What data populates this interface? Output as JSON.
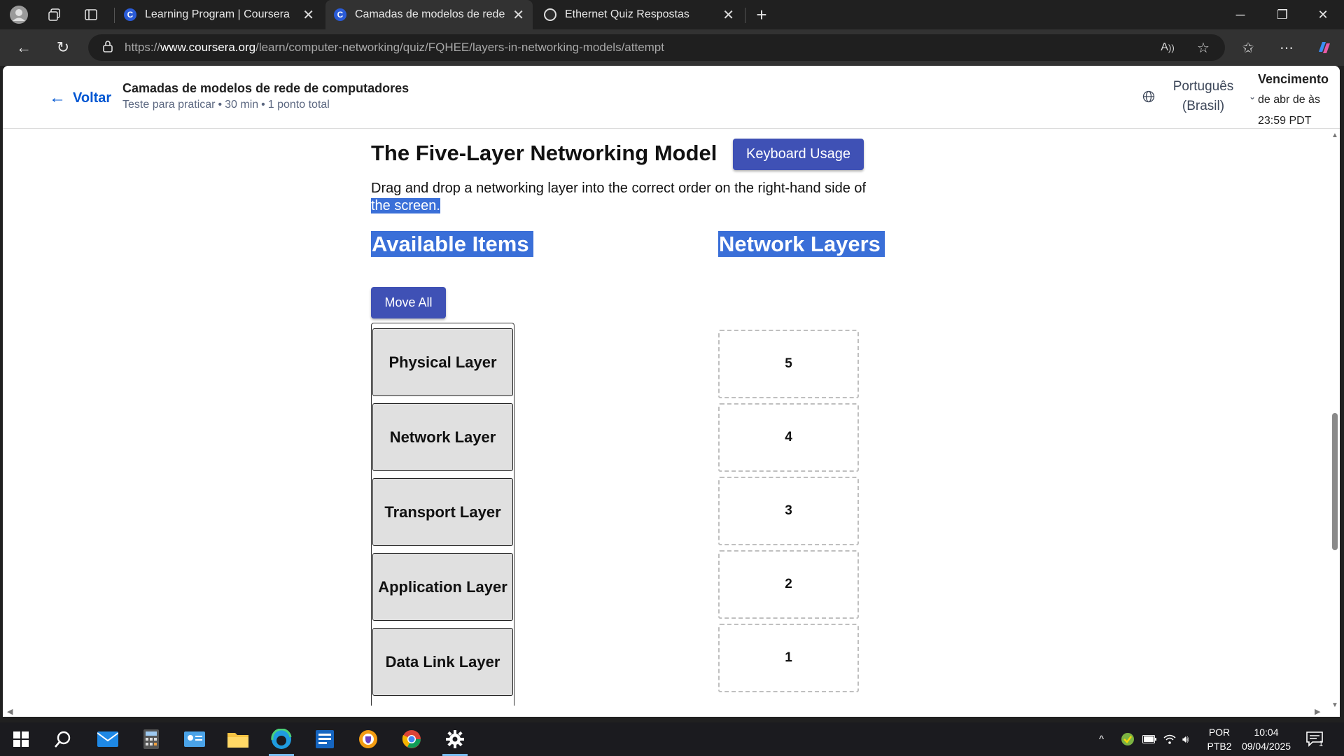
{
  "browser": {
    "tabs": [
      {
        "title": "Learning Program | Coursera",
        "favicon": "C",
        "active": false
      },
      {
        "title": "Camadas de modelos de rede de computadores",
        "favicon": "C",
        "active": true
      },
      {
        "title": "Ethernet Quiz Respostas",
        "favicon": "",
        "active": false
      }
    ],
    "url_scheme": "https://",
    "url_host": "www.coursera.org",
    "url_path": "/learn/computer-networking/quiz/FQHEE/layers-in-networking-models/attempt"
  },
  "header": {
    "back_label": "Voltar",
    "title": "Camadas de modelos de rede de computadores",
    "subtitle_type": "Teste para praticar",
    "subtitle_time": "30 min",
    "subtitle_points": "1 ponto total",
    "language_line1": "Português",
    "language_line2": "(Brasil)",
    "due_title": "Vencimento",
    "due_line1": "de abr de às",
    "due_line2": "23:59 PDT"
  },
  "quiz": {
    "title": "The Five-Layer Networking Model",
    "keyboard_button": "Keyboard Usage",
    "instruction_part1": "Drag and drop a networking layer into the correct order on the right-hand side of",
    "instruction_part2": "the screen.",
    "available_title": "Available Items",
    "layers_title": "Network Layers",
    "move_all_label": "Move All",
    "available_items": [
      "Physical Layer",
      "Network Layer",
      "Transport Layer",
      "Application Layer",
      "Data Link Layer"
    ],
    "slots": [
      "5",
      "4",
      "3",
      "2",
      "1"
    ]
  },
  "taskbar": {
    "lang_top": "POR",
    "lang_bottom": "PTB2",
    "time": "10:04",
    "date": "09/04/2025",
    "notification_count": "1"
  },
  "colors": {
    "accent_button": "#3f51b5",
    "selection": "#3a6fd8",
    "link": "#0056d2"
  }
}
